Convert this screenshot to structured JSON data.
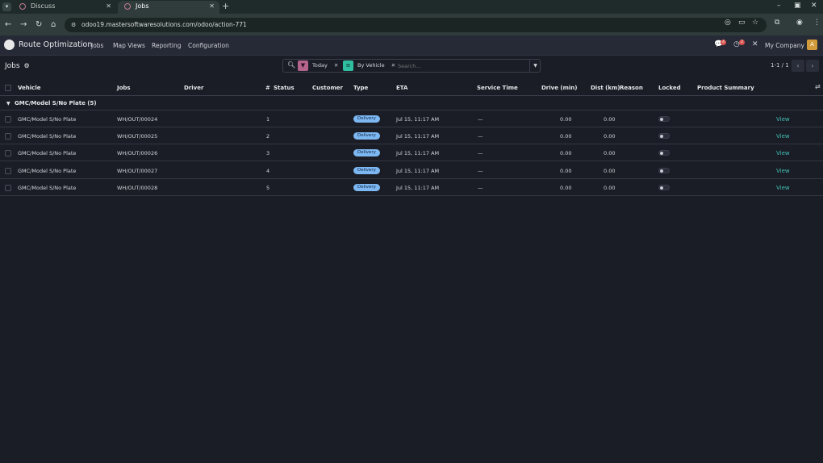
{
  "browser": {
    "tabs": [
      {
        "title": "Discuss"
      },
      {
        "title": "Jobs"
      }
    ],
    "new_tab": "+",
    "url": "odoo19.mastersoftwaresolutions.com/odoo/action-771",
    "window_controls": {
      "minimize": "–",
      "maximize": "▣",
      "close": "✕"
    }
  },
  "navbar": {
    "app_name": "Route Optimization",
    "menus": [
      "Jobs",
      "Map Views",
      "Reporting",
      "Configuration"
    ],
    "messages_badge": "4",
    "activity_badge": "2",
    "company": "My Company",
    "avatar_letter": "A"
  },
  "control_panel": {
    "title": "Jobs",
    "facets": [
      {
        "label": "Today",
        "color": "#b3648a",
        "icon": "filter-icon"
      },
      {
        "label": "By Vehicle",
        "color": "#2fbfa0",
        "icon": "group-icon"
      }
    ],
    "search_placeholder": "Search...",
    "pager": "1-1 / 1"
  },
  "table": {
    "columns": [
      "Vehicle",
      "Jobs",
      "Driver",
      "#",
      "Status",
      "Customer",
      "Type",
      "ETA",
      "Service Time",
      "Drive (min)",
      "Dist (km)",
      "Reason",
      "Locked",
      "Product Summary"
    ],
    "group_label": "GMC/Model S/No Plate (5)",
    "rows": [
      {
        "vehicle": "GMC/Model S/No Plate",
        "job": "WH/OUT/00024",
        "seq": "1",
        "type": "Delivery",
        "eta": "Jul 15, 11:17 AM",
        "service": "—",
        "drive": "0.00",
        "dist": "0.00",
        "action": "View"
      },
      {
        "vehicle": "GMC/Model S/No Plate",
        "job": "WH/OUT/00025",
        "seq": "2",
        "type": "Delivery",
        "eta": "Jul 15, 11:17 AM",
        "service": "—",
        "drive": "0.00",
        "dist": "0.00",
        "action": "View"
      },
      {
        "vehicle": "GMC/Model S/No Plate",
        "job": "WH/OUT/00026",
        "seq": "3",
        "type": "Delivery",
        "eta": "Jul 15, 11:17 AM",
        "service": "—",
        "drive": "0.00",
        "dist": "0.00",
        "action": "View"
      },
      {
        "vehicle": "GMC/Model S/No Plate",
        "job": "WH/OUT/00027",
        "seq": "4",
        "type": "Delivery",
        "eta": "Jul 15, 11:17 AM",
        "service": "—",
        "drive": "0.00",
        "dist": "0.00",
        "action": "View"
      },
      {
        "vehicle": "GMC/Model S/No Plate",
        "job": "WH/OUT/00028",
        "seq": "5",
        "type": "Delivery",
        "eta": "Jul 15, 11:17 AM",
        "service": "—",
        "drive": "0.00",
        "dist": "0.00",
        "action": "View"
      }
    ]
  },
  "colors": {
    "accent": "#3fc0b3",
    "pill": "#7db7f2",
    "badge": "#d9534f"
  }
}
